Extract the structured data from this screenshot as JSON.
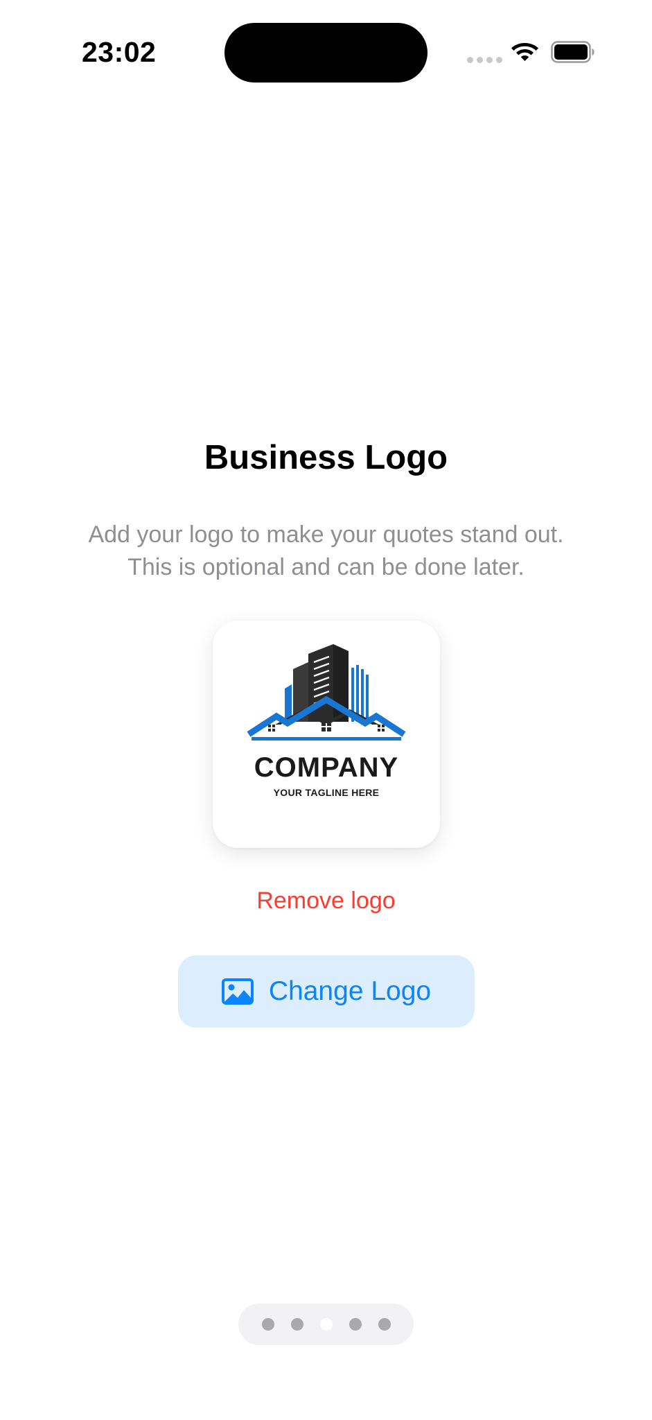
{
  "status_bar": {
    "time": "23:02"
  },
  "onboarding": {
    "title": "Business Logo",
    "subtitle": "Add your logo to make your quotes stand out. This is optional and can be done later."
  },
  "logo_preview": {
    "wordmark": "COMPANY",
    "tagline": "YOUR TAGLINE HERE",
    "colors": {
      "building_dark": "#2b2b2b",
      "building_blue": "#1976d2"
    }
  },
  "actions": {
    "remove_label": "Remove logo",
    "change_label": "Change Logo",
    "change_icon": "photo-icon"
  },
  "pagination": {
    "total_pages": 5,
    "current_page": 3
  },
  "colors": {
    "accent": "#0a84ff",
    "destructive": "#ff3b30",
    "button_bg": "#dceefd",
    "secondary_text": "#8e8e93"
  }
}
